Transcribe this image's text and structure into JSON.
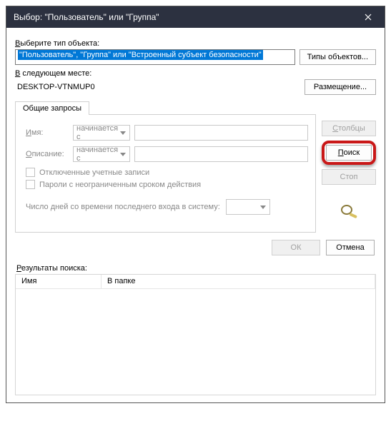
{
  "window": {
    "title": "Выбор: \"Пользователь\" или \"Группа\""
  },
  "object_section": {
    "label": "Выберите тип объекта:",
    "value": "\"Пользователь\", \"Группа\" или \"Встроенный субъект безопасности\"",
    "types_button": "Типы объектов..."
  },
  "location_section": {
    "label": "В следующем месте:",
    "value": "DESKTOP-VTNMUP0",
    "location_button": "Размещение..."
  },
  "tab": {
    "label": "Общие запросы"
  },
  "query": {
    "name_label": "Имя:",
    "name_mode": "начинается с",
    "desc_label": "Описание:",
    "desc_mode": "начинается с",
    "disabled_accounts": "Отключенные учетные записи",
    "non_expiring": "Пароли с неограниченным сроком действия",
    "days_label": "Число дней со времени последнего входа в систему:"
  },
  "side_buttons": {
    "columns": "Столбцы",
    "search": "Поиск",
    "stop": "Стоп"
  },
  "footer": {
    "ok": "ОК",
    "cancel": "Отмена"
  },
  "results": {
    "label": "Результаты поиска:",
    "col_name": "Имя",
    "col_folder": "В папке"
  }
}
